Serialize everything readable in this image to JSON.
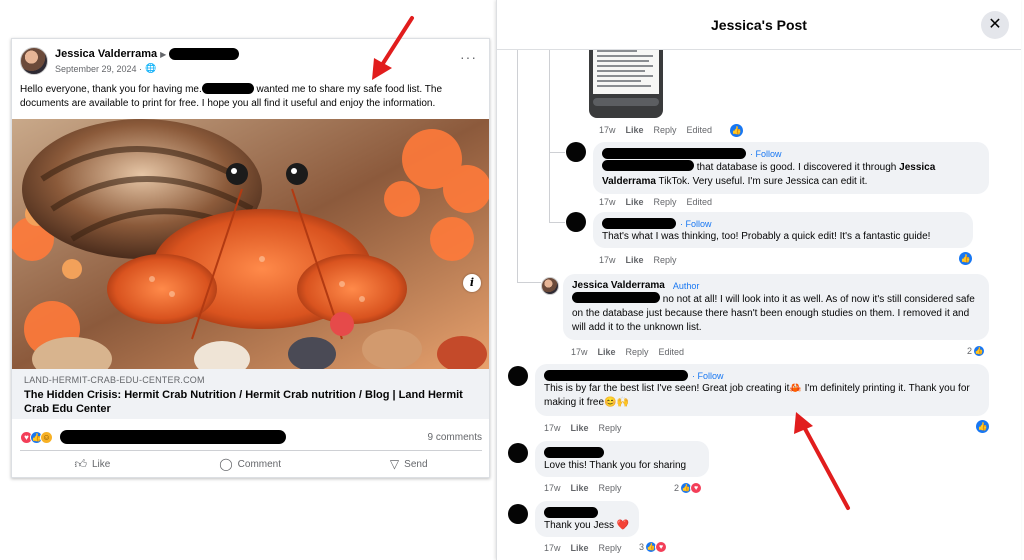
{
  "post": {
    "author": "Jessica Valderrama",
    "date": "September 29, 2024 · ",
    "text_part1": "Hello everyone, thank you for having me.",
    "text_part2": " wanted me to share my safe food list. The documents are available to print for free. I hope you all find it useful and enjoy the information.",
    "link_domain": "LAND-HERMIT-CRAB-EDU-CENTER.COM",
    "link_title": "The Hidden Crisis: Hermit Crab Nutrition / Hermit Crab nutrition / Blog | Land Hermit Crab Edu Center",
    "comments_count": "9 comments",
    "actions": {
      "like": "Like",
      "comment": "Comment",
      "send": "Send"
    }
  },
  "dialog": {
    "title": "Jessica's Post",
    "close": "✕"
  },
  "comments": [
    {
      "time": "17w",
      "like": "Like",
      "reply": "Reply",
      "edited": "Edited"
    },
    {
      "follow": "· Follow",
      "text_a": "that database is good. I discovered it through ",
      "bold": "Jessica Valderrama",
      "text_b": " TikTok. Very useful. I'm sure Jessica can edit it.",
      "time": "17w",
      "like": "Like",
      "reply": "Reply",
      "edited": "Edited"
    },
    {
      "follow": "· Follow",
      "text": "That's what I was thinking, too! Probably a quick edit! It's a fantastic guide!",
      "time": "17w",
      "like": "Like",
      "reply": "Reply"
    },
    {
      "author": "Jessica Valderrama",
      "tag": "Author",
      "text_a": " no not at all! I will look into it as well. As of now it's still considered safe on the database just because there hasn't been enough studies on them. I removed it and will add it to the unknown list.",
      "time": "17w",
      "like": "Like",
      "reply": "Reply",
      "edited": "Edited",
      "reaction_count": "2"
    },
    {
      "follow": "· Follow",
      "text_a": "This is by far the best list I've seen! Great job creating it",
      "emoji_a": "🦀",
      "text_b": " I'm definitely printing it. Thank you for making it free",
      "emoji_b": "😊🙌",
      "time": "17w",
      "like": "Like",
      "reply": "Reply"
    },
    {
      "text": "Love this! Thank you for sharing",
      "time": "17w",
      "like": "Like",
      "reply": "Reply",
      "reaction_count": "2"
    },
    {
      "text": "Thank you Jess ",
      "emoji": "❤️",
      "time": "17w",
      "like": "Like",
      "reply": "Reply",
      "reaction_count": "3"
    }
  ],
  "icons": {
    "like": "thumbs-up-icon",
    "comment": "comment-bubble-icon",
    "send": "send-icon",
    "info": "info-icon",
    "globe": "globe-icon",
    "more": "more-dots-icon"
  },
  "colors": {
    "accent": "#1877f2",
    "arrow": "#e11d1d",
    "bubble": "#f0f2f5"
  }
}
